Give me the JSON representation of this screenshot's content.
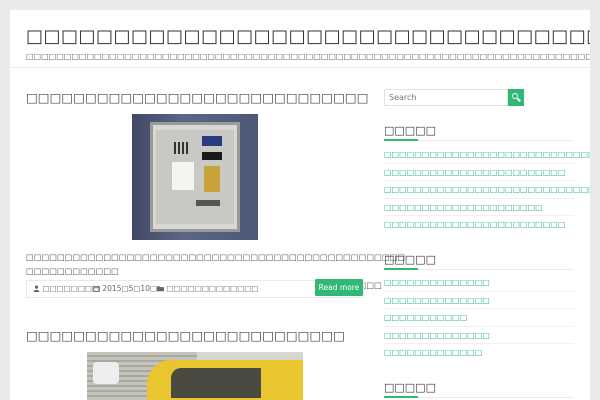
{
  "site": {
    "title": "□□□□□□□□□□□□□□□□□□□□□□□□□□□□□□□□□□□□□",
    "description": "□□□□□□□□□□□□□□□□□□□□□□□□□□□□□□□□□□□□□□□□□□□□□□□□□□□□□□□□□□□□□□□□□□□□□□□□□□□□□□□□□□□□"
  },
  "posts": [
    {
      "title": "□□□□□□□□□□□□□□□□□□□□□□□□□□□□□",
      "excerpt_line1": "□□□□□□□□□□□□□□□□□□□□□□□□□□□□□□□□□□□□□□□□□□□□□□□□□ □□□□□□□□□□□□",
      "excerpt_line2": "□□□□□□□□□□□□□□□□□□□□□□□□□□□□□□□□□□□□□□□□□□□□□□",
      "author": "□□□□□□□□",
      "date": "2015□5□10□",
      "category": "□□□□□□□□□□□□□",
      "read_more": "Read more"
    },
    {
      "title": "□□□□□□□□□□□□□□□□□□□□□□□□□□□"
    }
  ],
  "sidebar": {
    "search_placeholder": "Search",
    "widgets": [
      {
        "title": "□□□□□",
        "links": [
          "□□□□□□□□□□□□□□□□□□□□□□□□□□□□",
          "□□□□□□□□□□□□□□□□□□□□□□□□",
          "□□□□□□□□□□□□□□□□□□□□□□□□□□□□□",
          "□□□□□□□□□□□□□□□□□□□□□",
          "□□□□□□□□□□□□□□□□□□□□□□□□"
        ]
      },
      {
        "title": "□□□□□",
        "links": [
          "□□□□□□□□□□□□□□",
          "□□□□□□□□□□□□□□",
          "□□□□□□□□□□□",
          "□□□□□□□□□□□□□□",
          "□□□□□□□□□□□□□"
        ]
      },
      {
        "title": "□□□□□",
        "links": []
      }
    ]
  },
  "colors": {
    "accent": "#30b877",
    "page_bg": "#eaeaea",
    "content_bg": "#ffffff"
  },
  "icons": {
    "author": "user-icon",
    "date": "calendar-icon",
    "category": "folder-icon",
    "search": "search-icon"
  }
}
